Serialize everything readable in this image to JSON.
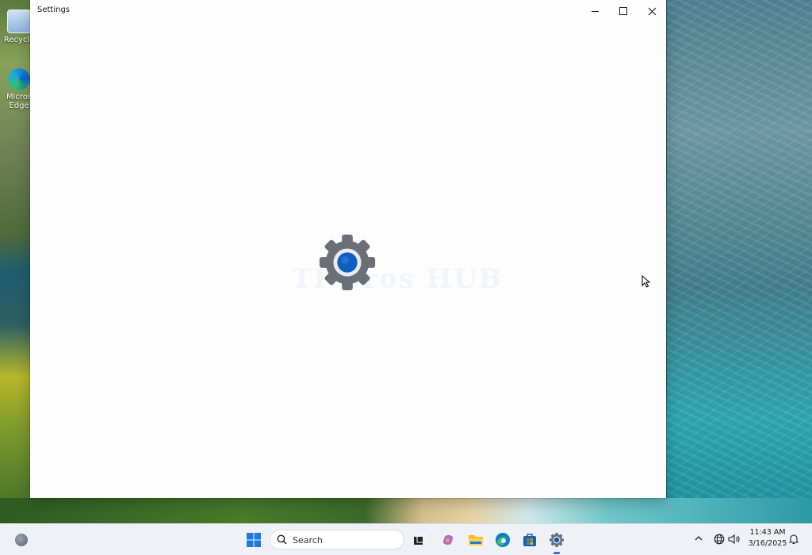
{
  "desktop": {
    "icons": [
      {
        "label": "Recycle"
      },
      {
        "label": "Micros Edge"
      }
    ]
  },
  "window": {
    "title": "Settings",
    "watermark": "TI Gros HUB"
  },
  "taskbar": {
    "search_placeholder": "Search",
    "clock": {
      "time": "11:43 AM",
      "date": "3/16/2025"
    }
  },
  "colors": {
    "accent": "#0f5fc0",
    "gear_grey": "#6b6f78"
  }
}
